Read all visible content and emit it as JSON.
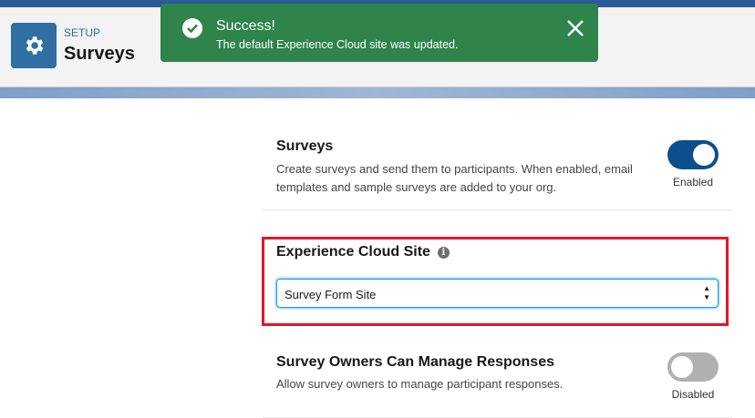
{
  "header": {
    "eyebrow": "SETUP",
    "title": "Surveys",
    "icon": "gear-icon"
  },
  "toast": {
    "title": "Success!",
    "message": "The default Experience Cloud site was updated.",
    "color": "#2e844a"
  },
  "sections": [
    {
      "title": "Surveys",
      "description": "Create surveys and send them to participants. When enabled, email templates and sample surveys are added to your org.",
      "toggle_on": true,
      "toggle_label": "Enabled"
    },
    {
      "title": "Experience Cloud Site",
      "selected": "Survey Form Site"
    },
    {
      "title": "Survey Owners Can Manage Responses",
      "description": "Allow survey owners to manage participant responses.",
      "toggle_on": false,
      "toggle_label": "Disabled"
    }
  ],
  "colors": {
    "accent": "#0b5cab",
    "highlight": "#e0182d"
  }
}
